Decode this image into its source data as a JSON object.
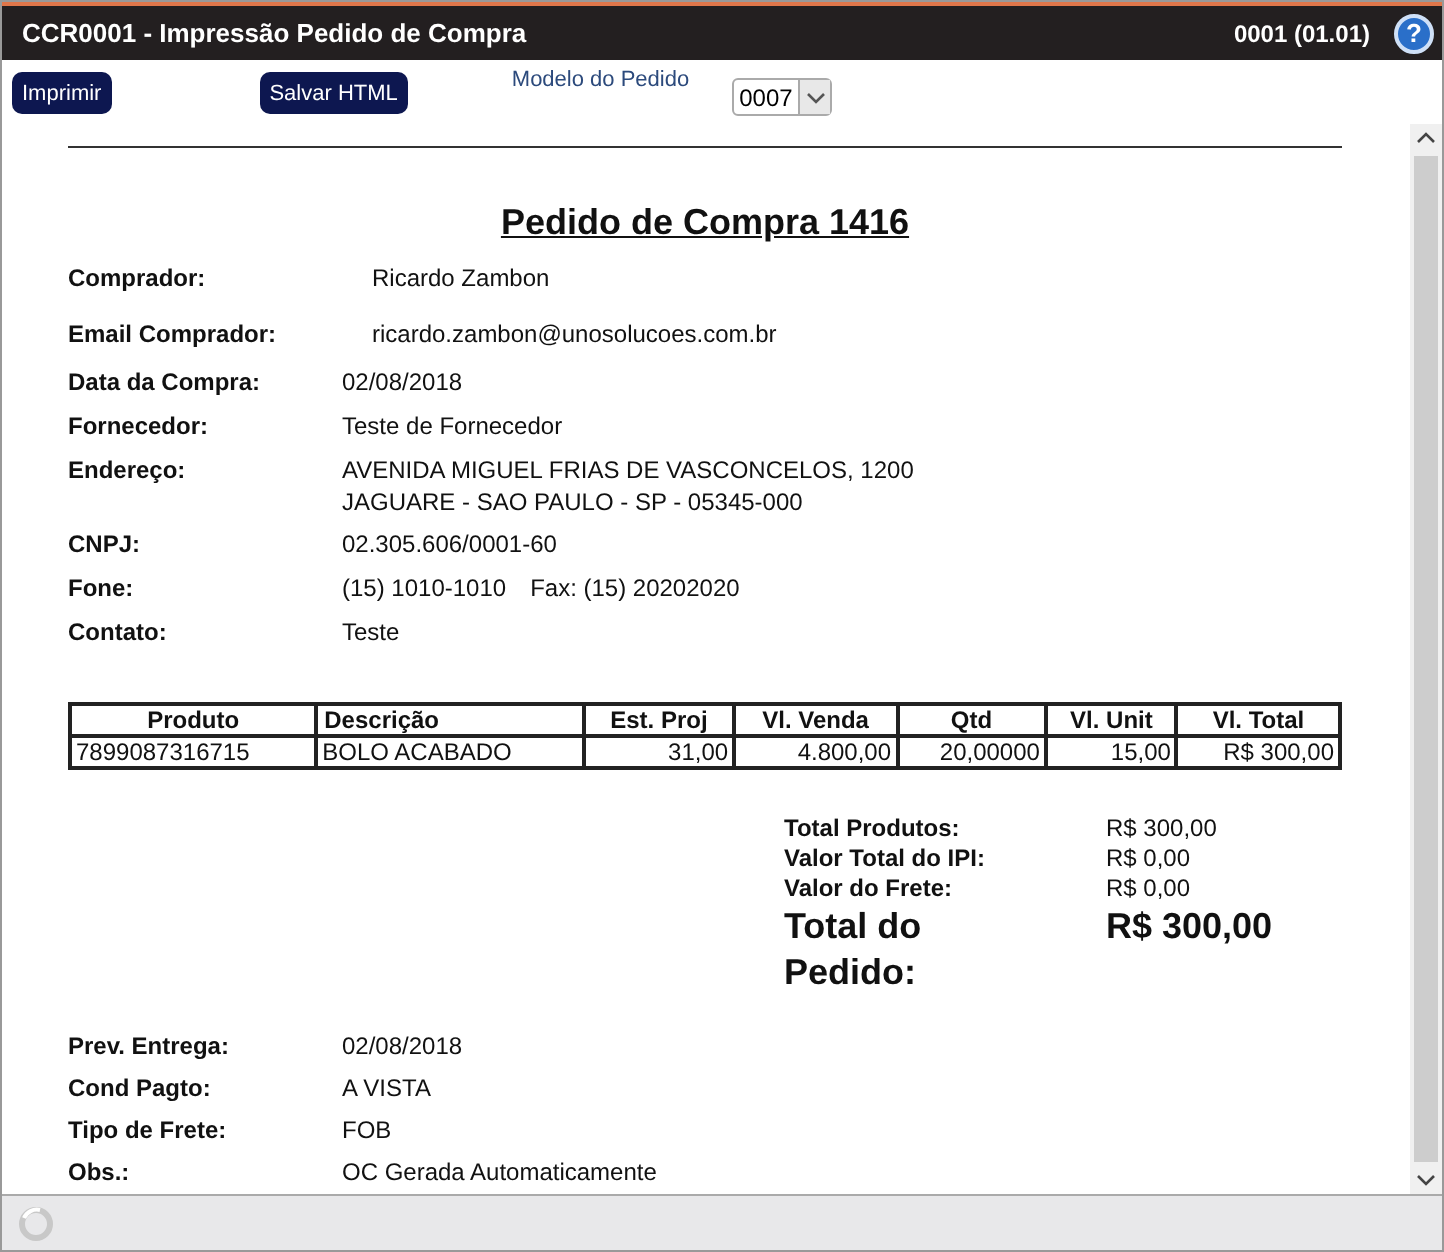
{
  "window": {
    "title": "CCR0001 - Impressão Pedido de Compra",
    "version": "0001 (01.01)",
    "help": "?"
  },
  "toolbar": {
    "buttons": [
      "Imprimir",
      "Salvar HTML"
    ],
    "model_label": "Modelo do Pedido",
    "model_value": "0007"
  },
  "document": {
    "title": "Pedido de Compra 1416",
    "header_fields": [
      {
        "label": "Comprador:",
        "kind": "wide",
        "values": [
          "Ricardo Zambon"
        ]
      },
      {
        "label": "Email Comprador:",
        "kind": "wide",
        "values": [
          "ricardo.zambon@unosolucoes.com.br"
        ]
      },
      {
        "label": "Data da Compra:",
        "kind": "inline",
        "values": [
          "02/08/2018"
        ]
      },
      {
        "label": "Fornecedor:",
        "kind": "inline",
        "values": [
          "Teste de Fornecedor"
        ]
      },
      {
        "label": "Endereço:",
        "kind": "stacked",
        "values": [
          "AVENIDA MIGUEL FRIAS DE VASCONCELOS, 1200",
          "JAGUARE - SAO PAULO - SP - 05345-000"
        ]
      },
      {
        "label": "CNPJ:",
        "kind": "inline",
        "values": [
          "02.305.606/0001-60"
        ]
      },
      {
        "label": "Fone:",
        "kind": "inline",
        "values": [
          "(15) 1010-1010",
          "Fax: (15) 20202020"
        ]
      },
      {
        "label": "Contato:",
        "kind": "inline",
        "values": [
          "Teste"
        ]
      }
    ],
    "table": {
      "columns": [
        "Produto",
        "Descrição",
        "Est. Proj",
        "Vl. Venda",
        "Qtd",
        "Vl. Unit",
        "Vl. Total"
      ],
      "rows": [
        [
          "7899087316715",
          "BOLO ACABADO",
          "31,00",
          "4.800,00",
          "20,00000",
          "15,00",
          "R$ 300,00"
        ]
      ]
    },
    "totals": [
      {
        "label": "Total Produtos:",
        "value": "R$ 300,00",
        "kind": "normal"
      },
      {
        "label": "Valor Total do IPI:",
        "value": "R$ 0,00",
        "kind": "normal"
      },
      {
        "label": "Valor do Frete:",
        "value": "R$ 0,00",
        "kind": "normal"
      },
      {
        "label": "Total do Pedido:",
        "value": "R$ 300,00",
        "kind": "grand"
      }
    ],
    "footer_fields": [
      {
        "label": "Prev. Entrega:",
        "values": [
          "02/08/2018"
        ]
      },
      {
        "label": "Cond Pagto:",
        "values": [
          "A VISTA"
        ]
      },
      {
        "label": "Tipo de Frete:",
        "values": [
          "FOB"
        ]
      },
      {
        "label": "Obs.:",
        "values": [
          "OC Gerada Automaticamente"
        ]
      }
    ]
  }
}
